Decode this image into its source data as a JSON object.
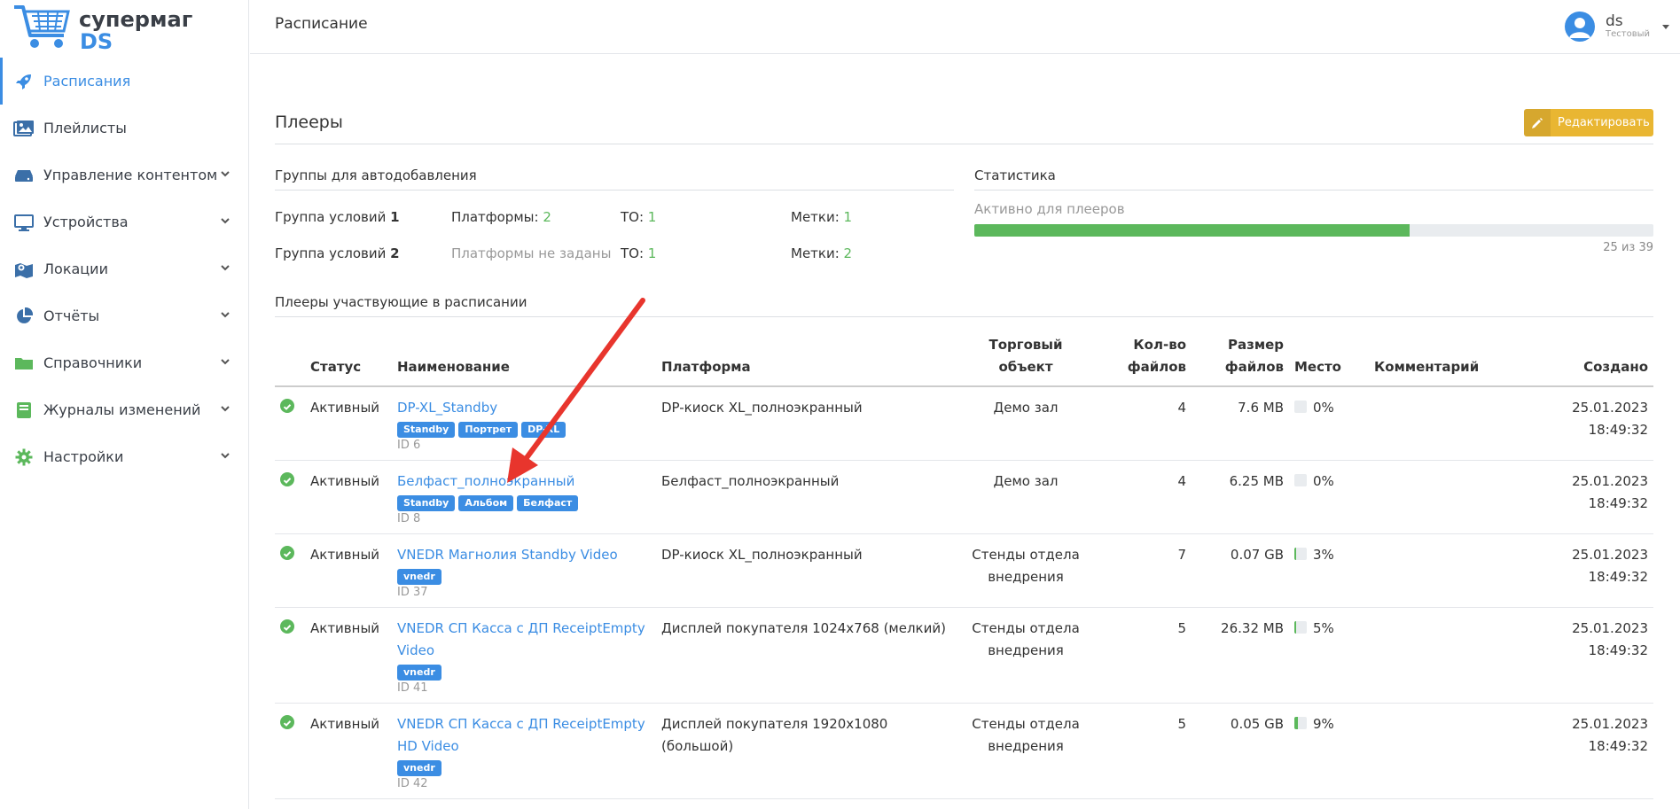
{
  "logo": {
    "line1": "супермаг",
    "line2": "DS"
  },
  "sidebar": {
    "items": [
      {
        "label": "Расписания",
        "icon": "rocket-icon",
        "active": true,
        "chevron": false
      },
      {
        "label": "Плейлисты",
        "icon": "images-icon",
        "active": false,
        "chevron": false
      },
      {
        "label": "Управление контентом",
        "icon": "hdd-icon",
        "active": false,
        "chevron": true
      },
      {
        "label": "Устройства",
        "icon": "monitor-icon",
        "active": false,
        "chevron": true
      },
      {
        "label": "Локации",
        "icon": "map-icon",
        "active": false,
        "chevron": true
      },
      {
        "label": "Отчёты",
        "icon": "pie-chart-icon",
        "active": false,
        "chevron": true
      },
      {
        "label": "Справочники",
        "icon": "folder-icon",
        "active": false,
        "chevron": true
      },
      {
        "label": "Журналы изменений",
        "icon": "book-icon",
        "active": false,
        "chevron": true
      },
      {
        "label": "Настройки",
        "icon": "gear-icon",
        "active": false,
        "chevron": true
      }
    ]
  },
  "header": {
    "title": "Расписание",
    "user_name": "ds",
    "user_role": "Тестовый"
  },
  "players": {
    "title": "Плееры",
    "edit_label": "Редактировать",
    "groups_title": "Группы для автодобавления",
    "groups": [
      {
        "name": "Группа условий ",
        "num": "1",
        "platforms_label": "Платформы: ",
        "platforms_value": "2",
        "to_label": "ТО: ",
        "to_value": "1",
        "tags_label": "Метки: ",
        "tags_value": "1"
      },
      {
        "name": "Группа условий ",
        "num": "2",
        "platforms_label": "Платформы не заданы",
        "platforms_value": "",
        "to_label": "ТО: ",
        "to_value": "1",
        "tags_label": "Метки: ",
        "tags_value": "2"
      }
    ],
    "stats_title": "Статистика",
    "stats_label": "Активно для плееров",
    "stats_active": 25,
    "stats_total": 39,
    "stats_text": "25 из 39",
    "table_title": "Плееры участвующие в расписании",
    "columns": {
      "status": "Статус",
      "name": "Наименование",
      "platform": "Платформа",
      "object": "Торговый объект",
      "files": "Кол-во файлов",
      "size": "Размер файлов",
      "place": "Место",
      "comment": "Комментарий",
      "created": "Создано"
    },
    "rows": [
      {
        "status": "Активный",
        "name": "DP-XL_Standby",
        "tags": [
          "Standby",
          "Портрет",
          "DP-XL"
        ],
        "id": "ID 6",
        "platform": "DP-киоск XL_полноэкранный",
        "object": "Демо зал",
        "files": "4",
        "size": "7.6 MB",
        "place": "0%",
        "place_pct": 0,
        "comment": "",
        "created_date": "25.01.2023",
        "created_time": "18:49:32"
      },
      {
        "status": "Активный",
        "name": "Белфаст_полноэкранный",
        "tags": [
          "Standby",
          "Альбом",
          "Белфаст"
        ],
        "id": "ID 8",
        "platform": "Белфаст_полноэкранный",
        "object": "Демо зал",
        "files": "4",
        "size": "6.25 MB",
        "place": "0%",
        "place_pct": 0,
        "comment": "",
        "created_date": "25.01.2023",
        "created_time": "18:49:32"
      },
      {
        "status": "Активный",
        "name": "VNEDR Магнолия Standby Video",
        "tags": [
          "vnedr"
        ],
        "id": "ID 37",
        "platform": "DP-киоск XL_полноэкранный",
        "object": "Стенды отдела внедрения",
        "files": "7",
        "size": "0.07 GB",
        "place": "3%",
        "place_pct": 3,
        "comment": "",
        "created_date": "25.01.2023",
        "created_time": "18:49:32"
      },
      {
        "status": "Активный",
        "name": "VNEDR СП Касса с ДП ReceiptEmpty Video",
        "tags": [
          "vnedr"
        ],
        "id": "ID 41",
        "platform": "Дисплей покупателя 1024x768 (мелкий)",
        "object": "Стенды отдела внедрения",
        "files": "5",
        "size": "26.32 MB",
        "place": "5%",
        "place_pct": 5,
        "comment": "",
        "created_date": "25.01.2023",
        "created_time": "18:49:32"
      },
      {
        "status": "Активный",
        "name": "VNEDR СП Касса с ДП ReceiptEmpty HD Video",
        "tags": [
          "vnedr"
        ],
        "id": "ID 42",
        "platform": "Дисплей покупателя 1920x1080 (большой)",
        "object": "Стенды отдела внедрения",
        "files": "5",
        "size": "0.05 GB",
        "place": "9%",
        "place_pct": 9,
        "comment": "",
        "created_date": "25.01.2023",
        "created_time": "18:49:32"
      }
    ]
  },
  "colors": {
    "accent": "#3b8de3",
    "success": "#5cb85c",
    "warning": "#e9b632",
    "arrow": "#e8352d"
  }
}
